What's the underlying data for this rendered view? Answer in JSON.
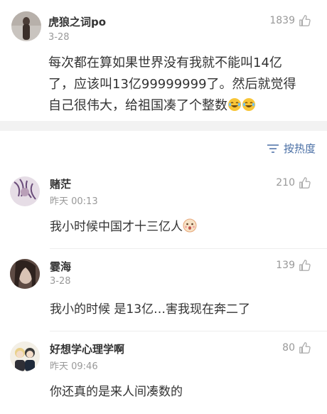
{
  "post": {
    "username": "虎狼之词po",
    "date": "3-28",
    "likes": "1839",
    "text": "每次都在算如果世界没有我就不能叫14亿了，应该叫13亿99999999了。然后就觉得自己很伟大，给祖国凑了个整数",
    "emojis": [
      "laughing-crying-emoji",
      "laughing-crying-emoji"
    ]
  },
  "sort": {
    "label": "按热度",
    "icon": "sort-icon"
  },
  "replies": [
    {
      "username": "赌茫",
      "date": "昨天 00:13",
      "likes": "210",
      "text": "我小时候中国才十三亿人",
      "emoji": "surprised-face-emoji"
    },
    {
      "username": "霎海",
      "date": "3-28",
      "likes": "139",
      "text": "我小的时候 是13亿…害我现在奔二了"
    },
    {
      "username": "好想学心理学啊",
      "date": "昨天 09:46",
      "likes": "80",
      "text": "你还真的是来人间凑数的"
    }
  ]
}
